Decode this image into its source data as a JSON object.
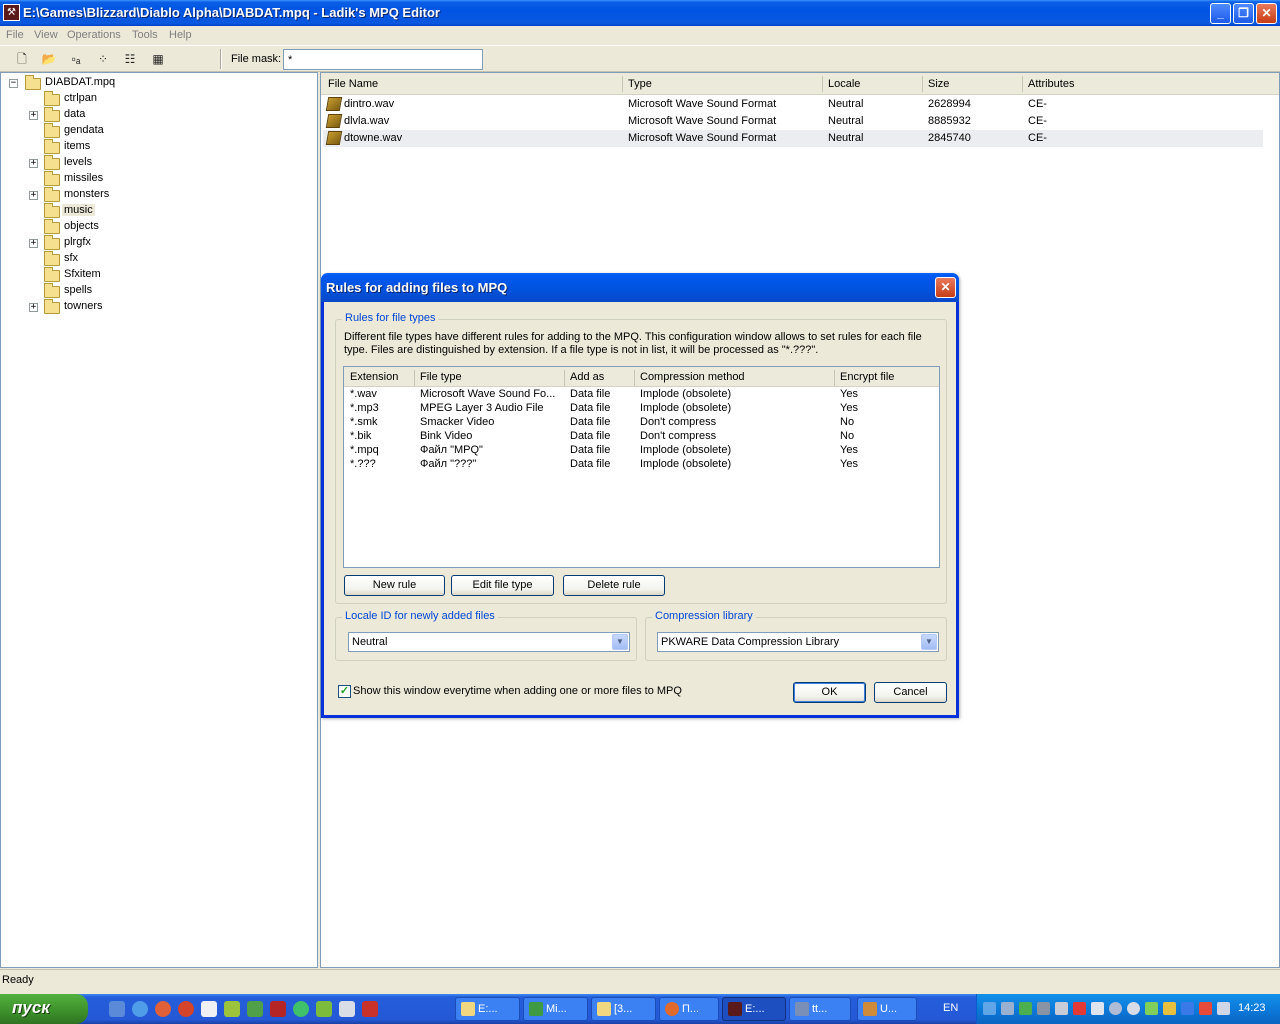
{
  "window": {
    "title": "E:\\Games\\Blizzard\\Diablo Alpha\\DIABDAT.mpq - Ladik's MPQ Editor",
    "minimize": "_",
    "maximize": "❐",
    "close": "✕"
  },
  "menu": [
    "File",
    "View",
    "Operations",
    "Tools",
    "Help"
  ],
  "toolbar": {
    "mask_label": "File mask:",
    "mask_value": "*"
  },
  "tree": {
    "root": "DIABDAT.mpq",
    "items": [
      "ctrlpan",
      "data",
      "gendata",
      "items",
      "levels",
      "missiles",
      "monsters",
      "music",
      "objects",
      "plrgfx",
      "sfx",
      "Sfxitem",
      "spells",
      "towners"
    ],
    "selected": "music"
  },
  "list": {
    "headers": [
      "File Name",
      "Type",
      "Locale",
      "Size",
      "Attributes"
    ],
    "rows": [
      {
        "name": "dintro.wav",
        "type": "Microsoft Wave Sound Format",
        "locale": "Neutral",
        "size": "2628994",
        "attr": "CE-"
      },
      {
        "name": "dlvla.wav",
        "type": "Microsoft Wave Sound Format",
        "locale": "Neutral",
        "size": "8885932",
        "attr": "CE-"
      },
      {
        "name": "dtowne.wav",
        "type": "Microsoft Wave Sound Format",
        "locale": "Neutral",
        "size": "2845740",
        "attr": "CE-"
      }
    ]
  },
  "status": "Ready",
  "dialog": {
    "title": "Rules for adding files to MPQ",
    "group_rules": "Rules for file types",
    "description": "Different file types have different rules for adding to the MPQ. This configuration window allows to set rules for each file type. Files are distinguished by extension. If a file type is not in list, it will be processed as \"*.???\".",
    "headers": [
      "Extension",
      "File type",
      "Add as",
      "Compression method",
      "Encrypt file"
    ],
    "rules": [
      {
        "ext": "*.wav",
        "type": "Microsoft Wave Sound Fo...",
        "add": "Data file",
        "comp": "Implode (obsolete)",
        "enc": "Yes"
      },
      {
        "ext": "*.mp3",
        "type": "MPEG Layer 3 Audio File",
        "add": "Data file",
        "comp": "Implode (obsolete)",
        "enc": "Yes"
      },
      {
        "ext": "*.smk",
        "type": "Smacker Video",
        "add": "Data file",
        "comp": "Don't compress",
        "enc": "No"
      },
      {
        "ext": "*.bik",
        "type": "Bink Video",
        "add": "Data file",
        "comp": "Don't compress",
        "enc": "No"
      },
      {
        "ext": "*.mpq",
        "type": "Файл \"MPQ\"",
        "add": "Data file",
        "comp": "Implode (obsolete)",
        "enc": "Yes"
      },
      {
        "ext": "*.???",
        "type": "Файл \"???\"",
        "add": "Data file",
        "comp": "Implode (obsolete)",
        "enc": "Yes"
      }
    ],
    "btn_new": "New rule",
    "btn_edit": "Edit file type",
    "btn_delete": "Delete rule",
    "group_locale": "Locale ID for newly added files",
    "locale_value": "Neutral",
    "group_compression": "Compression library",
    "compression_value": "PKWARE Data Compression Library",
    "show_label": "Show this window everytime when adding one or more files to MPQ",
    "show_checked": true,
    "btn_ok": "OK",
    "btn_cancel": "Cancel"
  },
  "taskbar": {
    "start": "пуск",
    "tasks": [
      "E:...",
      "Mi...",
      "[3...",
      "П...",
      "E:...",
      "tt...",
      "U..."
    ],
    "active_task_index": 4,
    "lang": "EN",
    "clock": "14:23"
  }
}
